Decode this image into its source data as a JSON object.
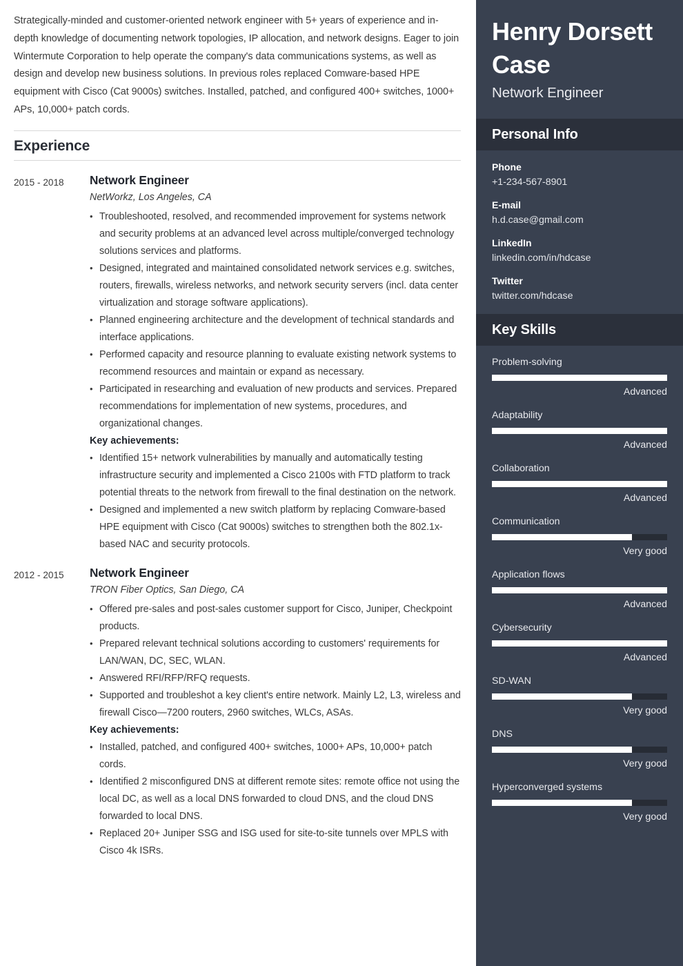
{
  "summary": "Strategically-minded and customer-oriented network engineer with 5+ years of experience and in-depth knowledge of documenting network topologies, IP allocation, and network designs. Eager to join Wintermute Corporation to help operate the company's data communications systems, as well as design and develop new business solutions. In previous roles replaced Comware-based HPE equipment with Cisco (Cat 9000s) switches. Installed, patched, and configured 400+ switches, 1000+ APs, 10,000+ patch cords.",
  "experience": {
    "heading": "Experience",
    "jobs": [
      {
        "dates": "2015 - 2018",
        "title": "Network Engineer",
        "company": "NetWorkz, Los Angeles, CA",
        "bullets": [
          "Troubleshooted, resolved, and recommended improvement for systems network and security problems at an advanced level across multiple/converged technology solutions services and platforms.",
          "Designed, integrated and maintained consolidated network services e.g. switches, routers, firewalls, wireless networks, and network security servers (incl. data center virtualization and storage software applications).",
          "Planned engineering architecture and the development of technical standards and interface applications.",
          "Performed capacity and resource planning to evaluate existing network systems to recommend resources and maintain or expand as necessary.",
          "Participated in researching and evaluation of new products and services. Prepared recommendations for implementation of new systems, procedures, and organizational changes."
        ],
        "achievements_label": "Key achievements:",
        "achievements": [
          "Identified 15+ network vulnerabilities by manually and automatically testing infrastructure security and implemented a Cisco 2100s with FTD platform to track potential threats to the network from firewall to the final destination on the network.",
          "Designed and implemented a new switch platform by replacing Comware-based HPE equipment with Cisco (Cat 9000s) switches to strengthen both the 802.1x-based NAC and security protocols."
        ]
      },
      {
        "dates": "2012 - 2015",
        "title": "Network Engineer",
        "company": "TRON Fiber Optics, San Diego, CA",
        "bullets": [
          "Offered pre-sales and post-sales customer support for Cisco, Juniper, Checkpoint products.",
          "Prepared relevant technical solutions according to customers' requirements for LAN/WAN, DC, SEC, WLAN.",
          "Answered RFI/RFP/RFQ requests.",
          "Supported and troubleshot a key client's entire network. Mainly L2, L3, wireless and firewall Cisco—7200 routers, 2960 switches, WLCs, ASAs."
        ],
        "achievements_label": "Key achievements:",
        "achievements": [
          "Installed, patched, and configured 400+ switches, 1000+ APs, 10,000+ patch cords.",
          "Identified 2 misconfigured DNS at different remote sites: remote office not using the local DC, as well as a local DNS forwarded to cloud DNS, and the cloud DNS forwarded to local DNS.",
          "Replaced 20+ Juniper SSG and ISG used for site-to-site tunnels over MPLS with Cisco 4k ISRs."
        ]
      }
    ]
  },
  "sidebar": {
    "name": "Henry Dorsett Case",
    "role": "Network Engineer",
    "personal_info": {
      "heading": "Personal Info",
      "items": [
        {
          "label": "Phone",
          "value": "+1-234-567-8901"
        },
        {
          "label": "E-mail",
          "value": "h.d.case@gmail.com"
        },
        {
          "label": "LinkedIn",
          "value": "linkedin.com/in/hdcase"
        },
        {
          "label": "Twitter",
          "value": "twitter.com/hdcase"
        }
      ]
    },
    "key_skills": {
      "heading": "Key Skills",
      "items": [
        {
          "name": "Problem-solving",
          "level": "Advanced",
          "percent": 100
        },
        {
          "name": "Adaptability",
          "level": "Advanced",
          "percent": 100
        },
        {
          "name": "Collaboration",
          "level": "Advanced",
          "percent": 100
        },
        {
          "name": "Communication",
          "level": "Very good",
          "percent": 80
        },
        {
          "name": "Application flows",
          "level": "Advanced",
          "percent": 100
        },
        {
          "name": "Cybersecurity",
          "level": "Advanced",
          "percent": 100
        },
        {
          "name": "SD-WAN",
          "level": "Very good",
          "percent": 80
        },
        {
          "name": "DNS",
          "level": "Very good",
          "percent": 80
        },
        {
          "name": "Hyperconverged systems",
          "level": "Very good",
          "percent": 80
        }
      ]
    },
    "colors": {
      "sidebar_bg": "#394150",
      "section_header_bg": "#2b303b",
      "bar_fill": "#ffffff",
      "bar_track": "#272c35"
    }
  }
}
